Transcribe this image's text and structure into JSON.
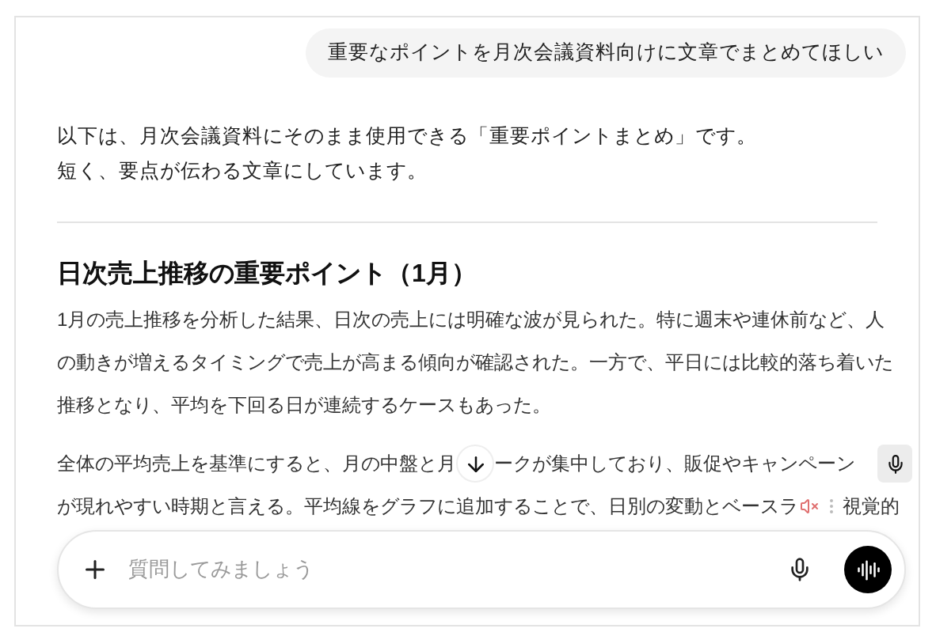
{
  "user_message": "重要なポイントを月次会議資料向けに文章でまとめてほしい",
  "intro": [
    "以下は、月次会議資料にそのまま使用できる「重要ポイントまとめ」です。",
    "短く、要点が伝わる文章にしています。"
  ],
  "heading": "日次売上推移の重要ポイント（1月）",
  "paragraph": "1月の売上推移を分析した結果、日次の売上には明確な波が見られた。特に週末や連休前など、人の動きが増えるタイミングで売上が高まる傾向が確認された。一方で、平日には比較的落ち着いた推移となり、平均を下回る日が連続するケースもあった。",
  "covered_lines": [
    {
      "items": [
        {
          "kind": "text",
          "text": "全体の平均売上を基準にすると、月の中盤と月"
        },
        {
          "kind": "scroll_button"
        },
        {
          "kind": "text",
          "text": "ークが集中しており、販促やキャンペーン"
        },
        {
          "kind": "mic_button"
        }
      ]
    },
    {
      "items": [
        {
          "kind": "text",
          "text": "が現れやすい時期と言える。平均線をグラフに追加することで、日別の変動とベースラ"
        },
        {
          "kind": "toolbar"
        },
        {
          "kind": "text",
          "text": "視覚的"
        }
      ]
    }
  ],
  "composer": {
    "placeholder": "質問してみましょう"
  }
}
